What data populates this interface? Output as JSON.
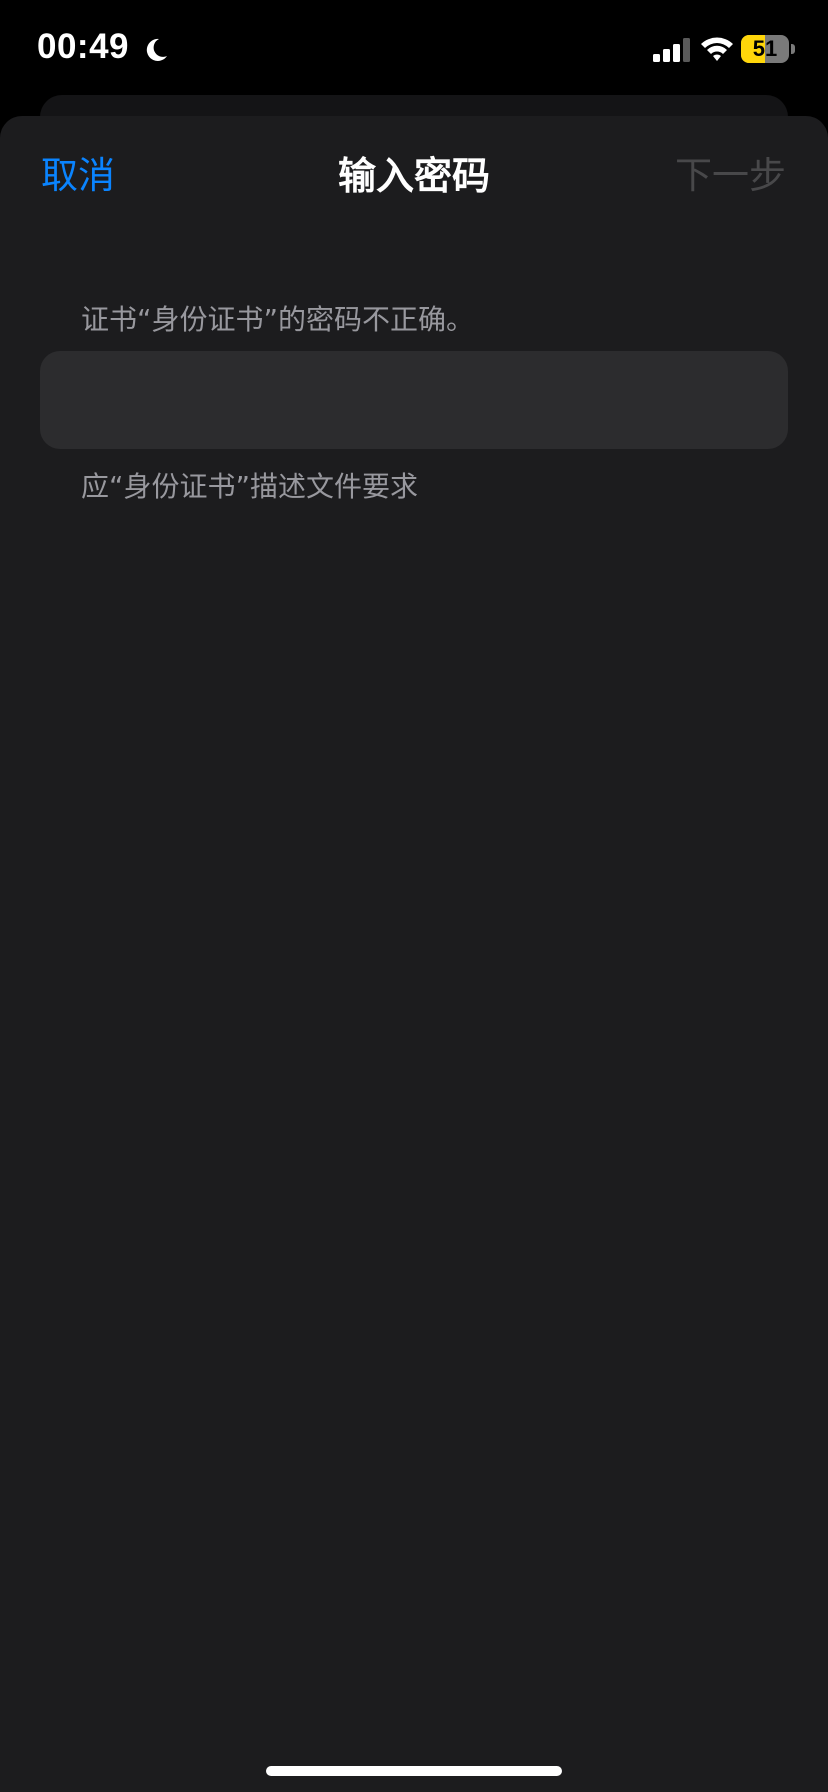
{
  "status_bar": {
    "time": "00:49",
    "focus_icon": "moon-icon",
    "signal_icon": "cellular-signal-icon",
    "wifi_icon": "wifi-icon",
    "battery_percent": "51",
    "battery_level": 0.51,
    "battery_color": "#ffd60a"
  },
  "nav": {
    "cancel_label": "取消",
    "title": "输入密码",
    "next_label": "下一步",
    "accent_color": "#0a84ff"
  },
  "form": {
    "error_message": "证书“身份证书”的密码不正确。",
    "password_value": "",
    "footer_text": "应“身份证书”描述文件要求"
  }
}
